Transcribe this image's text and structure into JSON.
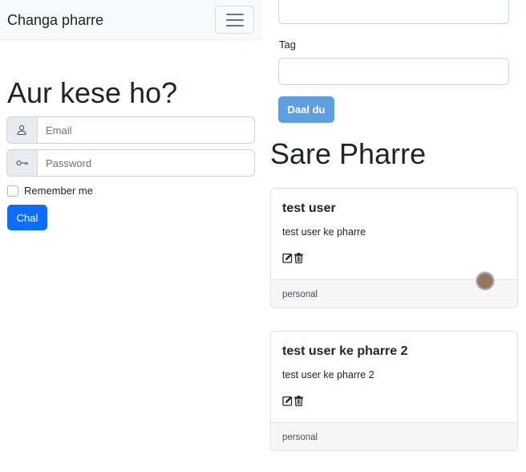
{
  "navbar": {
    "brand": "Changa pharre"
  },
  "login": {
    "greeting": "Aur kese ho?",
    "email_placeholder": "Email",
    "password_placeholder": "Password",
    "remember_label": "Remember me",
    "remember_checked": false,
    "submit_label": "Chal"
  },
  "form": {
    "tag_label": "Tag",
    "tag_value": "",
    "submit_label": "Daal du"
  },
  "list": {
    "heading": "Sare Pharre",
    "cards": [
      {
        "title": "test user",
        "text": "test user ke pharre",
        "tag": "personal"
      },
      {
        "title": "test user ke pharre 2",
        "text": "test user ke pharre 2",
        "tag": "personal"
      }
    ]
  },
  "icons": {
    "email": "user-icon",
    "password": "key-icon",
    "edit": "edit-icon",
    "delete": "trash-icon",
    "menu": "hamburger-icon"
  },
  "colors": {
    "primary": "#0d6efd",
    "primary_muted": "#5e9fe0",
    "navbar_bg": "#f8f9fa"
  }
}
